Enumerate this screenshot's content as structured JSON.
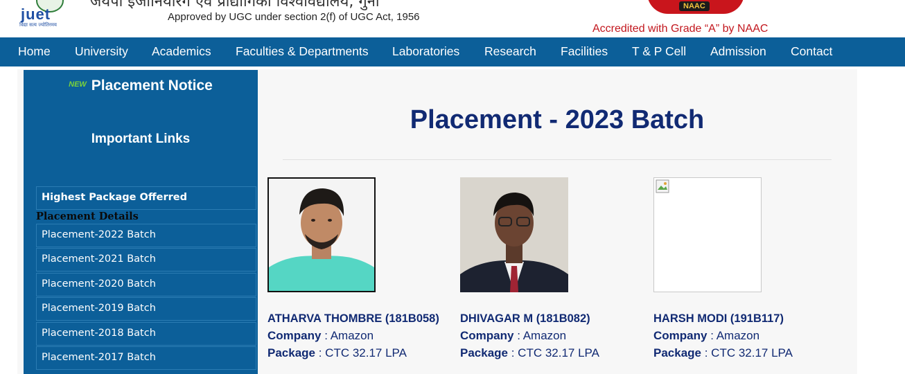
{
  "header": {
    "logo_text": "juet",
    "logo_tagline": "विद्या सत्य ज्योतिरमय",
    "hindi_title_fragment": "जयपी इंजीनियरिंग एवं प्रौद्योगिकी विश्वविद्यालय, गुना",
    "approved_text": "Approved by UGC under section 2(f) of UGC Act, 1956",
    "naac_label": "NAAC",
    "accredited_text": "Accredited with Grade “A” by NAAC"
  },
  "nav": {
    "items": [
      "Home",
      "University",
      "Academics",
      "Faculties & Departments",
      "Laboratories",
      "Research",
      "Facilities",
      "T & P Cell",
      "Admission",
      "Contact"
    ]
  },
  "sidebar": {
    "new_badge": "NEW",
    "notice_title": "Placement Notice",
    "links_title": "Important Links",
    "highest_package": "Highest Package Offerred",
    "details_heading": "Placement Details",
    "batches": [
      "Placement-2022 Batch",
      "Placement-2021 Batch",
      "Placement-2020 Batch",
      "Placement-2019 Batch",
      "Placement-2018 Batch",
      "Placement-2017 Batch"
    ]
  },
  "main": {
    "title": "Placement - 2023 Batch",
    "company_label": "Company",
    "package_label": "Package",
    "separator": " : ",
    "students": [
      {
        "name": "ATHARVA THOMBRE (181B058)",
        "company": "Amazon",
        "package": "CTC 32.17 LPA"
      },
      {
        "name": "DHIVAGAR M (181B082)",
        "company": "Amazon",
        "package": "CTC 32.17 LPA"
      },
      {
        "name": "HARSH MODI (191B117)",
        "company": "Amazon",
        "package": "CTC 32.17 LPA"
      }
    ]
  },
  "colors": {
    "nav": "#0c5f99",
    "title": "#112a73",
    "accent_red": "#c2161d"
  }
}
